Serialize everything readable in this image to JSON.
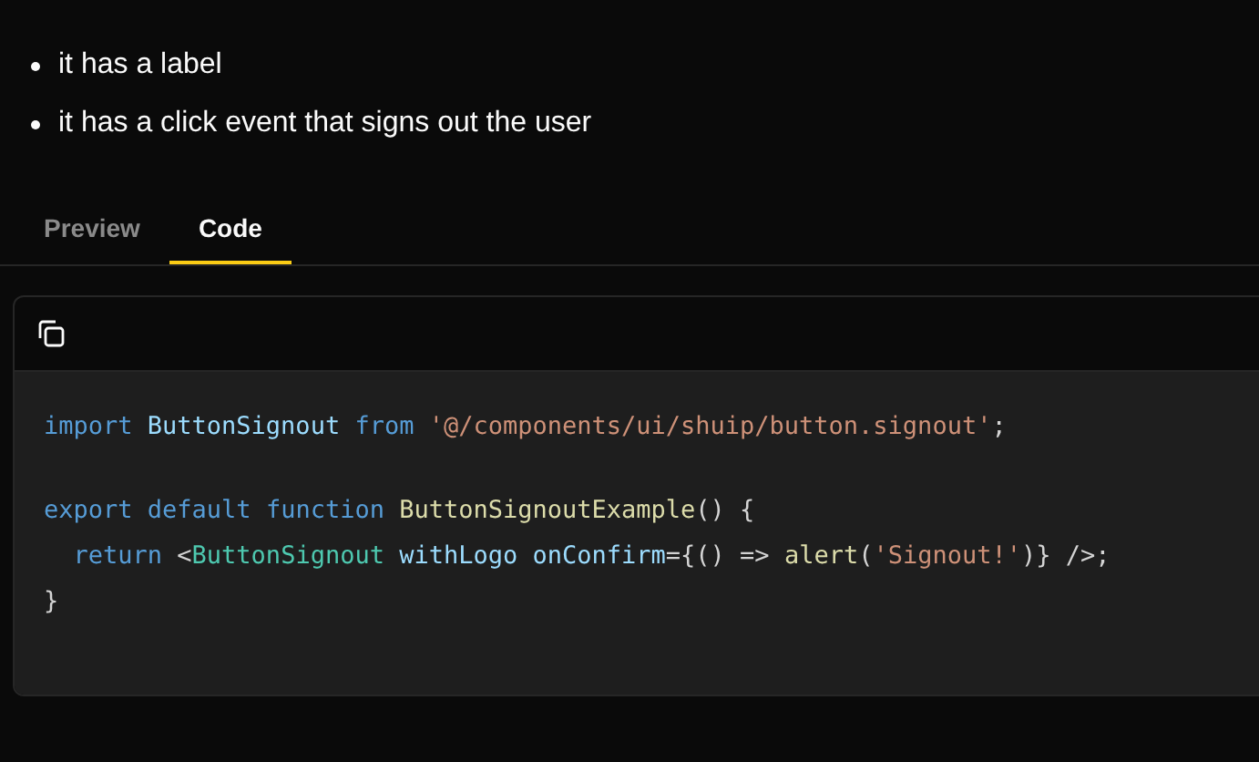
{
  "bullets": [
    "it has a label",
    "it has a click event that signs out the user"
  ],
  "tabs": [
    {
      "label": "Preview",
      "selected": false
    },
    {
      "label": "Code",
      "selected": true
    }
  ],
  "code_lines": [
    {
      "kind": "code",
      "tokens": [
        {
          "kind": "keyword",
          "text": "import"
        },
        {
          "kind": "ident",
          "text": " ButtonSignout"
        },
        {
          "kind": "keyword",
          "text": " from"
        },
        {
          "kind": "string",
          "text": " '@/components/ui/shuip/button.signout'"
        },
        {
          "kind": "plain",
          "text": ";"
        }
      ]
    },
    {
      "kind": "blank"
    },
    {
      "kind": "code",
      "tokens": [
        {
          "kind": "keyword",
          "text": "export"
        },
        {
          "kind": "keyword",
          "text": " default"
        },
        {
          "kind": "keyword",
          "text": " function"
        },
        {
          "kind": "func",
          "text": " ButtonSignoutExample"
        },
        {
          "kind": "plain",
          "text": "() {"
        }
      ]
    },
    {
      "kind": "code",
      "tokens": [
        {
          "kind": "keyword",
          "text": "  return"
        },
        {
          "kind": "plain",
          "text": " <"
        },
        {
          "kind": "tag",
          "text": "ButtonSignout"
        },
        {
          "kind": "ident",
          "text": " withLogo"
        },
        {
          "kind": "ident",
          "text": " onConfirm"
        },
        {
          "kind": "plain",
          "text": "={() => "
        },
        {
          "kind": "func",
          "text": "alert"
        },
        {
          "kind": "plain",
          "text": "("
        },
        {
          "kind": "string",
          "text": "'Signout!'"
        },
        {
          "kind": "plain",
          "text": ")} />;"
        }
      ]
    },
    {
      "kind": "code",
      "tokens": [
        {
          "kind": "plain",
          "text": "}"
        }
      ]
    }
  ]
}
